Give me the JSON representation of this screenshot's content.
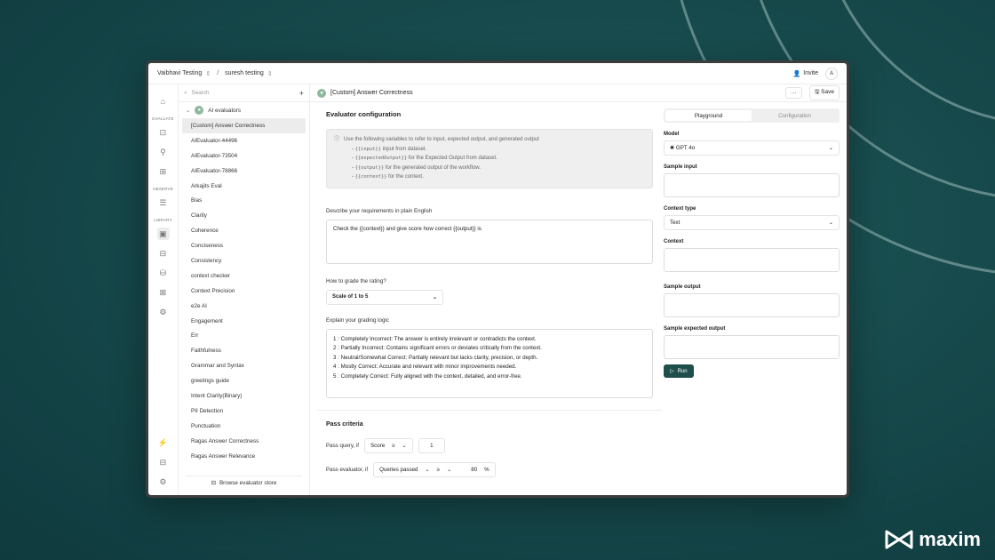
{
  "brand": {
    "name": "maxim"
  },
  "topbar": {
    "workspace": "Vaibhavi Testing",
    "project": "suresh testing",
    "invite_label": "Invite",
    "avatar_letter": "A"
  },
  "rail": {
    "evaluate_label": "EVALUATE",
    "observe_label": "OBSERVE",
    "library_label": "LIBRARY"
  },
  "sidebar": {
    "search_placeholder": "Search",
    "folder_name": "AI evaluators",
    "items": [
      "[Custom] Answer Correctness",
      "AIEvaluator-44496",
      "AIEvaluator-73504",
      "AIEvaluator-78866",
      "Arkajits Eval",
      "Bias",
      "Clarity",
      "Coherence",
      "Conciseness",
      "Consistency",
      "context checker",
      "Context Precision",
      "e2e AI",
      "Engagement",
      "Err",
      "Faithfulness",
      "Grammar and Syntax",
      "greetings guide",
      "Intent Clarity(Binary)",
      "PII Detection",
      "Punctuation",
      "Ragas Answer Correctness",
      "Ragas Answer Relevance"
    ],
    "browse_label": "Browse evaluator store"
  },
  "header": {
    "title": "[Custom] Answer Correctness",
    "more_label": "···",
    "save_label": "Save"
  },
  "config": {
    "title": "Evaluator configuration",
    "info_intro": "Use the following variables to refer to input, expected output, and generated output",
    "vars": [
      {
        "var": "{{input}}",
        "desc": "input from dataset."
      },
      {
        "var": "{{expectedOutput}}",
        "desc": "for the Expected Output from dataset."
      },
      {
        "var": "{{output}}",
        "desc": "for the generated output of the workflow."
      },
      {
        "var": "{{context}}",
        "desc": "for the context."
      }
    ],
    "requirements_label": "Describe your requirements in plain English",
    "requirements_value": "Check the {{context}} and give score how correct {{output}} is",
    "grade_label": "How to grade the rating?",
    "grade_value": "Scale of 1 to 5",
    "logic_label": "Explain your grading logic",
    "logic_lines": [
      "1 : Completely Incorrect: The answer is entirely irrelevant or contradicts the context.",
      "2 : Partially Incorrect: Contains significant errors or deviates critically from the context.",
      "3 : Neutral/Somewhat Correct: Partially relevant but lacks clarity, precision, or depth.",
      "4 : Mostly Correct: Accurate and relevant with minor improvements needed.",
      "5 : Completely Correct: Fully aligned with the context, detailed, and error-free."
    ]
  },
  "pass": {
    "title": "Pass criteria",
    "query_label": "Pass query, if",
    "query_field": "Score",
    "query_op": "≥",
    "query_value": "1",
    "eval_label": "Pass evaluator, if",
    "eval_field": "Queries passed",
    "eval_op": "≥",
    "eval_value": "80",
    "eval_unit": "%"
  },
  "playground": {
    "tab_playground": "Playground",
    "tab_configuration": "Configuration",
    "model_label": "Model",
    "model_value": "GPT 4o",
    "sample_input_label": "Sample input",
    "context_type_label": "Context type",
    "context_type_value": "Text",
    "context_label": "Context",
    "sample_output_label": "Sample output",
    "sample_expected_label": "Sample expected output",
    "run_label": "Run"
  }
}
